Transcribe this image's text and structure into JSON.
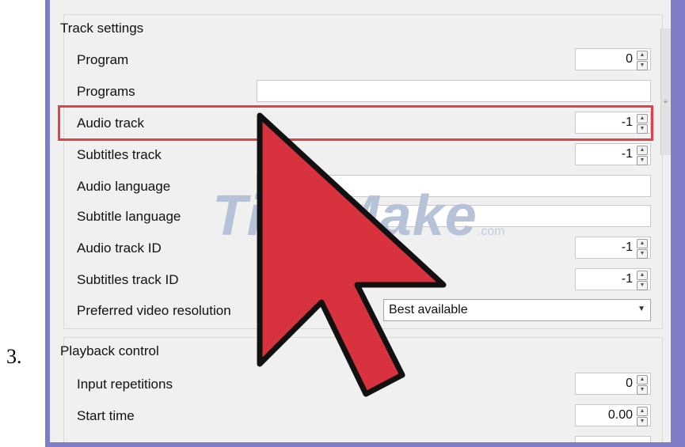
{
  "step": {
    "number": "3."
  },
  "track_settings": {
    "title": "Track settings",
    "program": {
      "label": "Program",
      "value": "0"
    },
    "programs": {
      "label": "Programs",
      "value": ""
    },
    "audio_track": {
      "label": "Audio track",
      "value": "-1"
    },
    "subtitles_track": {
      "label": "Subtitles track",
      "value": "-1"
    },
    "audio_language": {
      "label": "Audio language",
      "value": ""
    },
    "subtitle_language": {
      "label": "Subtitle language",
      "value": ""
    },
    "audio_track_id": {
      "label": "Audio track ID",
      "value": "-1"
    },
    "subtitles_track_id": {
      "label": "Subtitles track ID",
      "value": "-1"
    },
    "preferred_video_resolution": {
      "label": "Preferred video resolution",
      "value": "Best available"
    }
  },
  "playback_control": {
    "title": "Playback control",
    "input_repetitions": {
      "label": "Input repetitions",
      "value": "0"
    },
    "start_time": {
      "label": "Start time",
      "value": "0.00"
    }
  },
  "watermark": {
    "brand": "TipsMake",
    "suffix": ".com"
  },
  "colors": {
    "highlight": "#e0424a",
    "arrow": "#d9323f",
    "frame": "#7f7dc8"
  },
  "icons": {
    "spin": "spin-arrows-icon",
    "combo": "dropdown-arrow-icon",
    "pointer": "big-arrow-pointer-icon"
  }
}
